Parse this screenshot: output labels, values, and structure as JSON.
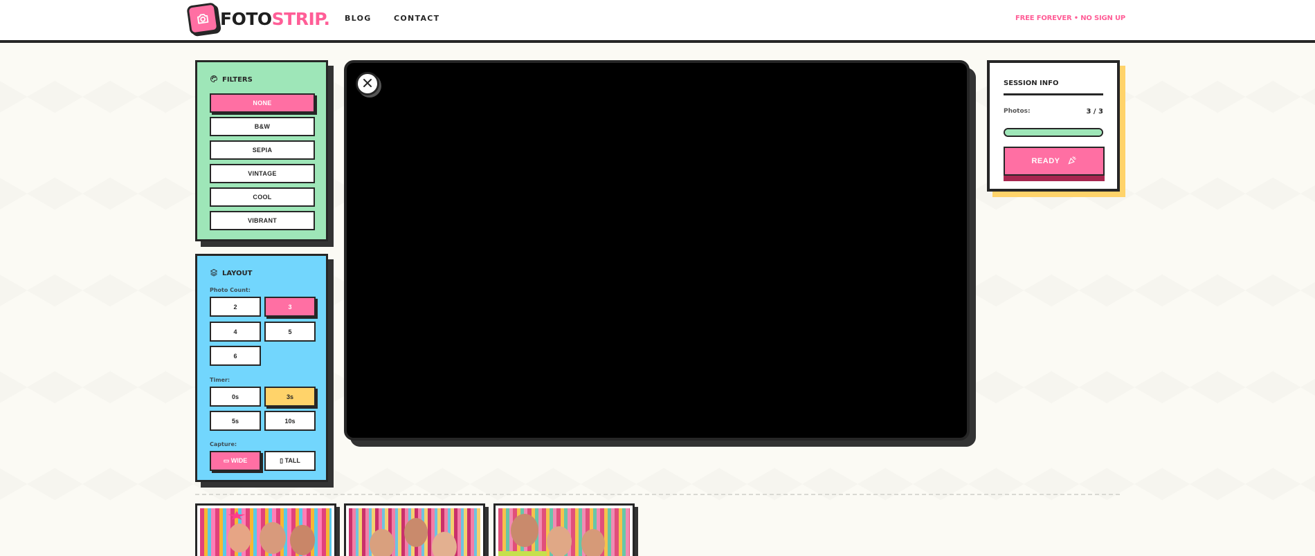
{
  "brand": {
    "part1": "FOTO",
    "part2": "STRIP."
  },
  "nav": {
    "blog": "BLOG",
    "contact": "CONTACT"
  },
  "tagline": "FREE FOREVER • NO SIGN UP",
  "filters": {
    "title": "FILTERS",
    "options": [
      "NONE",
      "B&W",
      "SEPIA",
      "VINTAGE",
      "COOL",
      "VIBRANT"
    ],
    "selected": "NONE"
  },
  "layout": {
    "title": "LAYOUT",
    "photo_count_label": "Photo Count:",
    "photo_counts": [
      "2",
      "3",
      "4",
      "5",
      "6"
    ],
    "photo_count_selected": "3",
    "timer_label": "Timer:",
    "timers": [
      "0s",
      "3s",
      "5s",
      "10s"
    ],
    "timer_selected": "3s",
    "capture_label": "Capture:",
    "capture_options": [
      "▭ WIDE",
      "▯ TALL"
    ],
    "capture_selected": "▭ WIDE"
  },
  "session": {
    "title": "SESSION INFO",
    "photos_label": "Photos:",
    "photos_value": "3 / 3",
    "progress_fraction": 1.0,
    "ready_label": "READY"
  },
  "colors": {
    "accent_pink": "#ff6fa3",
    "mint": "#9ee6b8",
    "sky": "#72d6fd",
    "yellow": "#ffd36a",
    "ink": "#262626"
  },
  "icons": {
    "logo": "camera-icon",
    "filters": "palette-icon",
    "layout": "layers-icon",
    "close": "close-icon",
    "ready": "party-popper-icon"
  }
}
